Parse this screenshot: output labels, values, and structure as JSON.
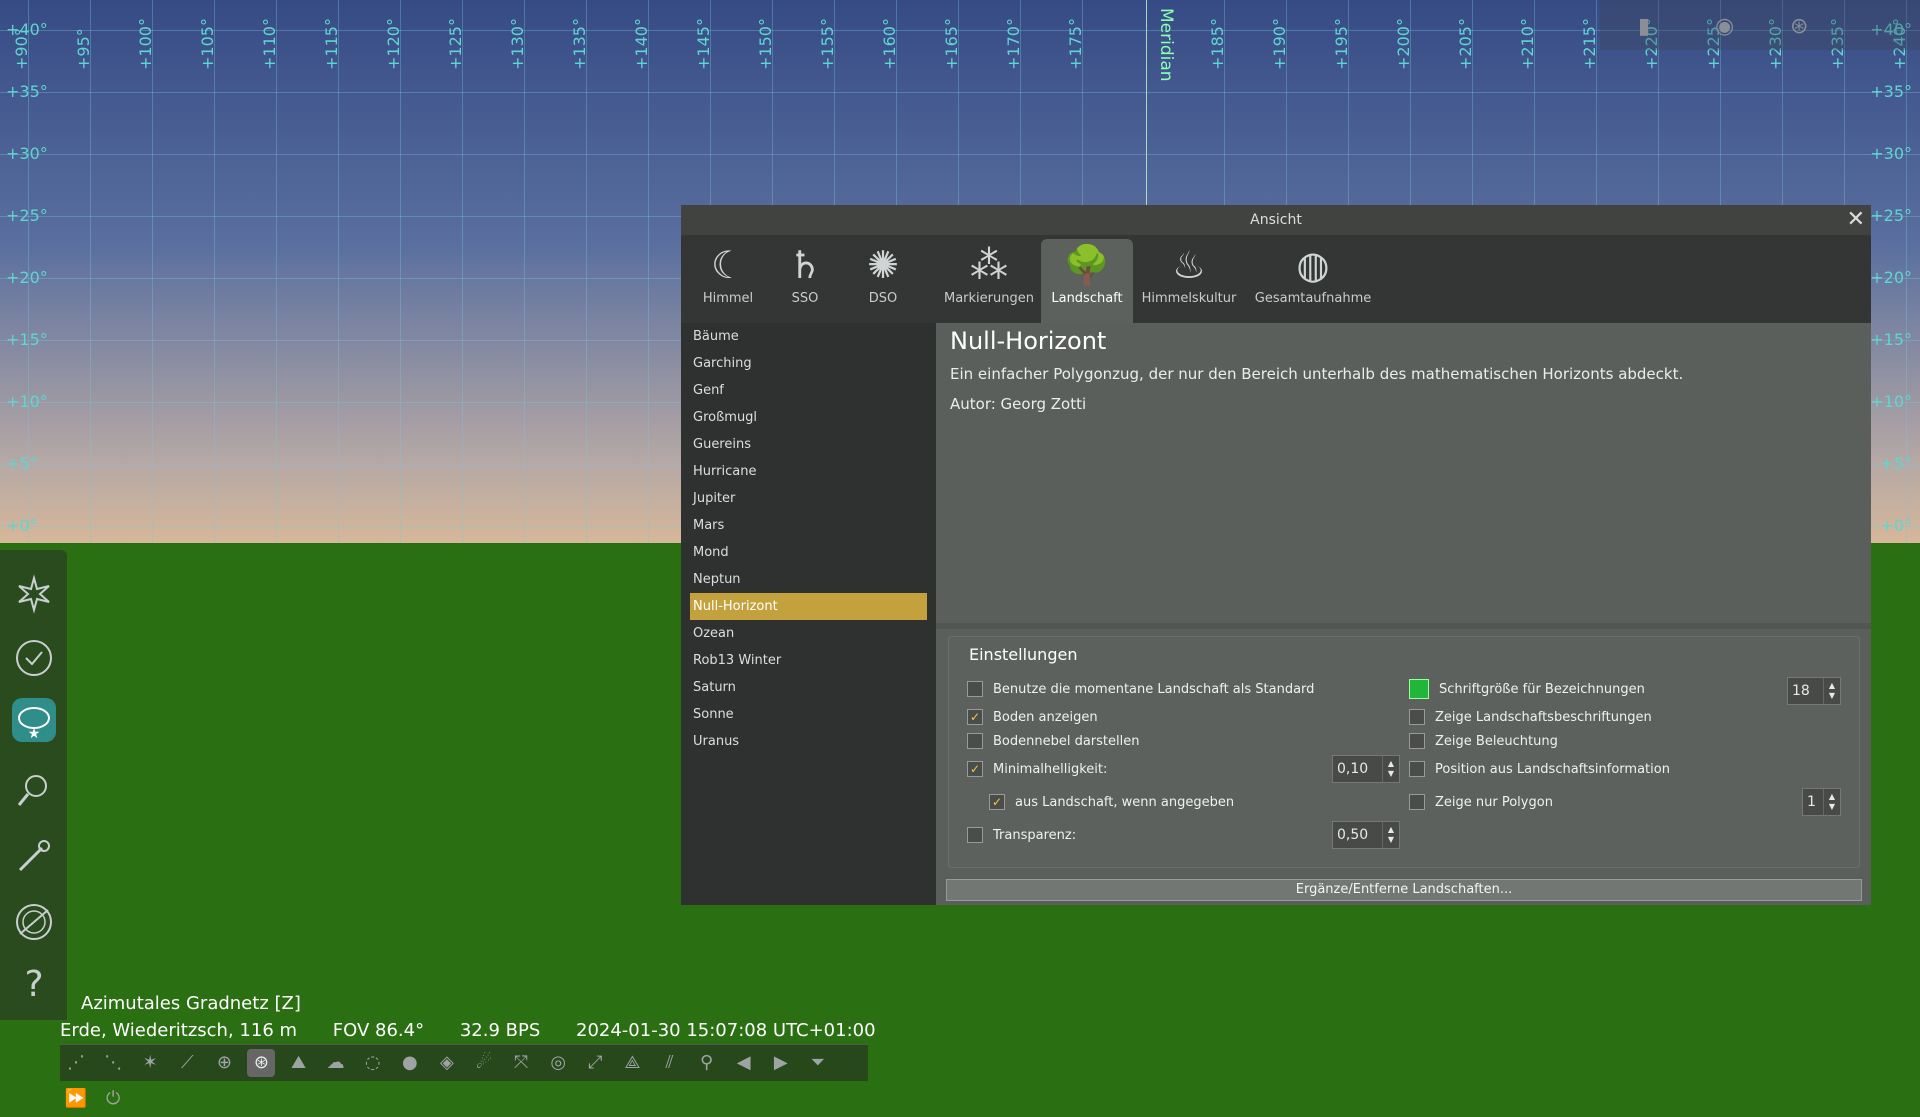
{
  "sky": {
    "az_labels": [
      "+90°",
      "+95°",
      "+100°",
      "+105°",
      "+110°",
      "+115°",
      "+120°",
      "+125°",
      "+130°",
      "+135°",
      "+140°",
      "+145°",
      "+150°",
      "+155°",
      "+160°",
      "+165°",
      "+170°",
      "+175°",
      "+185°",
      "+190°",
      "+195°",
      "+200°",
      "+205°",
      "+210°",
      "+215°",
      "+220°",
      "+225°",
      "+230°",
      "+235°",
      "+240°"
    ],
    "meridian": "Meridian",
    "alt_labels": [
      "+40°",
      "+35°",
      "+30°",
      "+25°",
      "+20°",
      "+15°",
      "+10°",
      "+5°",
      "+0°"
    ]
  },
  "status": {
    "projection": "Azimutales Gradnetz  [Z]",
    "location": "Erde, Wiederitzsch, 116 m",
    "fov": "FOV 86.4°",
    "fps": "32.9 BPS",
    "datetime": "2024-01-30 15:07:08 UTC+01:00"
  },
  "dialog": {
    "title": "Ansicht",
    "tabs": [
      {
        "label": "Himmel",
        "icon": "sky-icon"
      },
      {
        "label": "SSO",
        "icon": "solar-system-icon"
      },
      {
        "label": "DSO",
        "icon": "galaxy-icon"
      },
      {
        "label": "Markierungen",
        "icon": "markings-icon"
      },
      {
        "label": "Landschaft",
        "icon": "landscape-icon"
      },
      {
        "label": "Himmelskultur",
        "icon": "skyculture-icon"
      },
      {
        "label": "Gesamtaufnahme",
        "icon": "survey-icon"
      }
    ],
    "active_tab": "Landschaft",
    "landscapes": [
      "Bäume",
      "Garching",
      "Genf",
      "Großmugl",
      "Guereins",
      "Hurricane",
      "Jupiter",
      "Mars",
      "Mond",
      "Neptun",
      "Null-Horizont",
      "Ozean",
      "Rob13 Winter",
      "Saturn",
      "Sonne",
      "Uranus"
    ],
    "selected": "Null-Horizont",
    "detail": {
      "name": "Null-Horizont",
      "description": "Ein einfacher Polygonzug, der nur den Bereich unterhalb des mathematischen Horizonts abdeckt.",
      "author": "Autor: Georg Zotti"
    },
    "settings": {
      "title": "Einstellungen",
      "use_default": "Benutze die momentane Landschaft als Standard",
      "show_ground": "Boden anzeigen",
      "fog": "Bodennebel darstellen",
      "min_brightness": "Minimalhelligkeit:",
      "min_brightness_value": "0,10",
      "from_landscape": "aus Landschaft, wenn angegeben",
      "transparency": "Transparenz:",
      "transparency_value": "0,50",
      "font_size": "Schriftgröße für Bezeichnungen",
      "font_size_value": "18",
      "labels": "Zeige Landschaftsbeschriftungen",
      "illumination": "Zeige Beleuchtung",
      "position": "Position aus Landschaftsinformation",
      "polygon_only": "Zeige nur Polygon",
      "polygon_value": "1",
      "checked_mark": "✓",
      "label_color": "#21b53a"
    },
    "add_remove": "Ergänze/Entferne Landschaften...",
    "close": "✕"
  }
}
